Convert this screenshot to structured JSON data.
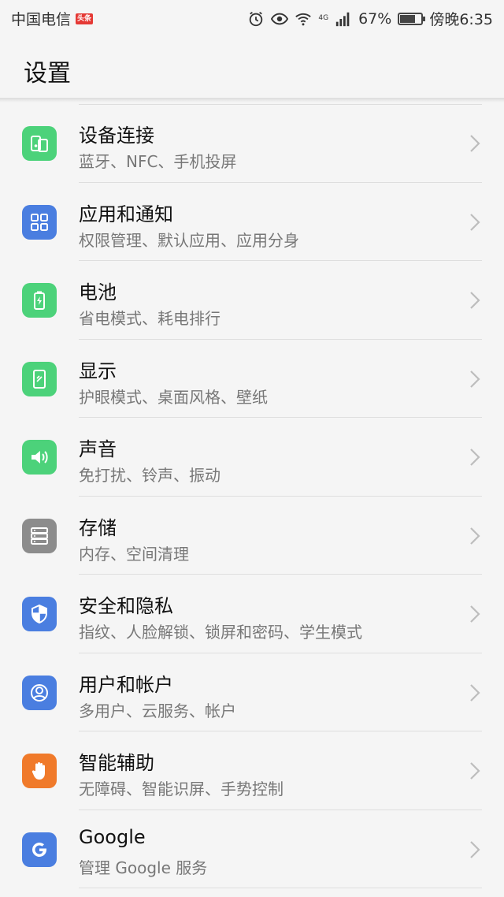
{
  "status_bar": {
    "carrier": "中国电信",
    "badge": "头条",
    "network": "4G",
    "battery": "67%",
    "battery_level": 0.67,
    "time": "傍晚6:35",
    "icons": [
      "alarm-icon",
      "eye-icon",
      "wifi-icon",
      "signal-icon",
      "battery-icon"
    ]
  },
  "header": {
    "title": "设置"
  },
  "settings": [
    {
      "title": "设备连接",
      "subtitle": "蓝牙、NFC、手机投屏",
      "icon": "device-connection-icon",
      "color": "#4cd27a"
    },
    {
      "title": "应用和通知",
      "subtitle": "权限管理、默认应用、应用分身",
      "icon": "apps-grid-icon",
      "color": "#4a7ee0"
    },
    {
      "title": "电池",
      "subtitle": "省电模式、耗电排行",
      "icon": "battery-icon",
      "color": "#4cd27a"
    },
    {
      "title": "显示",
      "subtitle": "护眼模式、桌面风格、壁纸",
      "icon": "display-icon",
      "color": "#4cd27a"
    },
    {
      "title": "声音",
      "subtitle": "免打扰、铃声、振动",
      "icon": "speaker-icon",
      "color": "#4cd27a"
    },
    {
      "title": "存储",
      "subtitle": "内存、空间清理",
      "icon": "storage-icon",
      "color": "#8c8c8c"
    },
    {
      "title": "安全和隐私",
      "subtitle": "指纹、人脸解锁、锁屏和密码、学生模式",
      "icon": "shield-icon",
      "color": "#4a7ee0"
    },
    {
      "title": "用户和帐户",
      "subtitle": "多用户、云服务、帐户",
      "icon": "user-icon",
      "color": "#4a7ee0"
    },
    {
      "title": "智能辅助",
      "subtitle": "无障碍、智能识屏、手势控制",
      "icon": "hand-icon",
      "color": "#f07a2a"
    },
    {
      "title": "Google",
      "subtitle": "管理 Google 服务",
      "icon": "google-icon",
      "color": "#4a7ee0"
    }
  ]
}
